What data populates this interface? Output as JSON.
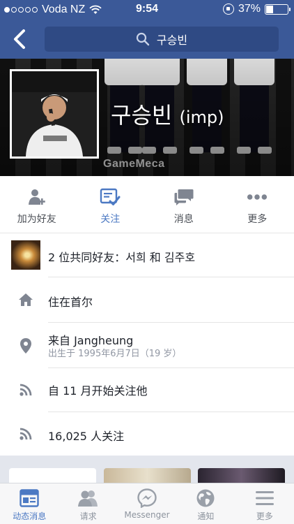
{
  "status_bar": {
    "carrier": "Voda NZ",
    "time": "9:54",
    "battery": "37%",
    "battery_level": 0.37,
    "signal_dots_filled": 1,
    "signal_dots_total": 5
  },
  "nav": {
    "search_query": "구승빈",
    "back_icon": "chevron-left-icon",
    "search_icon": "search-icon"
  },
  "profile": {
    "name": "구승빈",
    "alt_name": "(imp)",
    "cover_watermark": "GameMeca"
  },
  "actions": [
    {
      "label": "加为好友",
      "icon": "add-friend-icon"
    },
    {
      "label": "关注",
      "icon": "follow-icon",
      "active": true
    },
    {
      "label": "消息",
      "icon": "message-icon"
    },
    {
      "label": "更多",
      "icon": "more-icon"
    }
  ],
  "info": {
    "mutual_friends": "2 位共同好友：서희 和 김주호",
    "lives_in": "住在首尔",
    "from": "来自 Jangheung",
    "born": "出生于 1995年6月7日（19 岁）",
    "following_since": "自 11 月开始关注他",
    "followers": "16,025 人关注"
  },
  "tabs": [
    {
      "label": "动态消息",
      "icon": "news-feed-icon",
      "active": true
    },
    {
      "label": "请求",
      "icon": "friend-requests-icon"
    },
    {
      "label": "Messenger",
      "icon": "messenger-icon"
    },
    {
      "label": "通知",
      "icon": "notifications-globe-icon"
    },
    {
      "label": "更多",
      "icon": "menu-icon"
    }
  ],
  "colors": {
    "brand": "#3b5998",
    "accent": "#4c79c3",
    "icon_gray": "#7f8591"
  }
}
